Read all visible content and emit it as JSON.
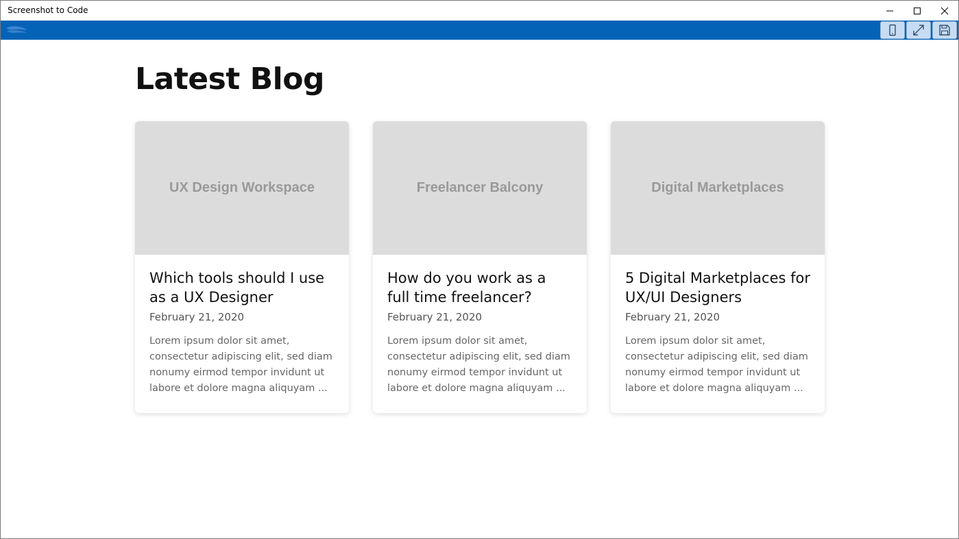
{
  "window": {
    "title": "Screenshot to Code"
  },
  "toolbar": {
    "accent": "#0563b7",
    "buttons": [
      "phone-icon",
      "expand-icon",
      "save-icon"
    ]
  },
  "page": {
    "title": "Latest Blog"
  },
  "cards": [
    {
      "image_label": "UX Design Workspace",
      "title": "Which tools should I use as a UX Designer",
      "date": "February 21, 2020",
      "excerpt": "Lorem ipsum dolor sit amet, consectetur adipiscing elit, sed diam nonumy eirmod tempor invidunt ut labore et dolore magna aliquyam ..."
    },
    {
      "image_label": "Freelancer Balcony",
      "title": "How do you work as a full time freelancer?",
      "date": "February 21, 2020",
      "excerpt": "Lorem ipsum dolor sit amet, consectetur adipiscing elit, sed diam nonumy eirmod tempor invidunt ut labore et dolore magna aliquyam ..."
    },
    {
      "image_label": "Digital Marketplaces",
      "title": "5 Digital Marketplaces for UX/UI Designers",
      "date": "February 21, 2020",
      "excerpt": "Lorem ipsum dolor sit amet, consectetur adipiscing elit, sed diam nonumy eirmod tempor invidunt ut labore et dolore magna aliquyam ..."
    }
  ]
}
